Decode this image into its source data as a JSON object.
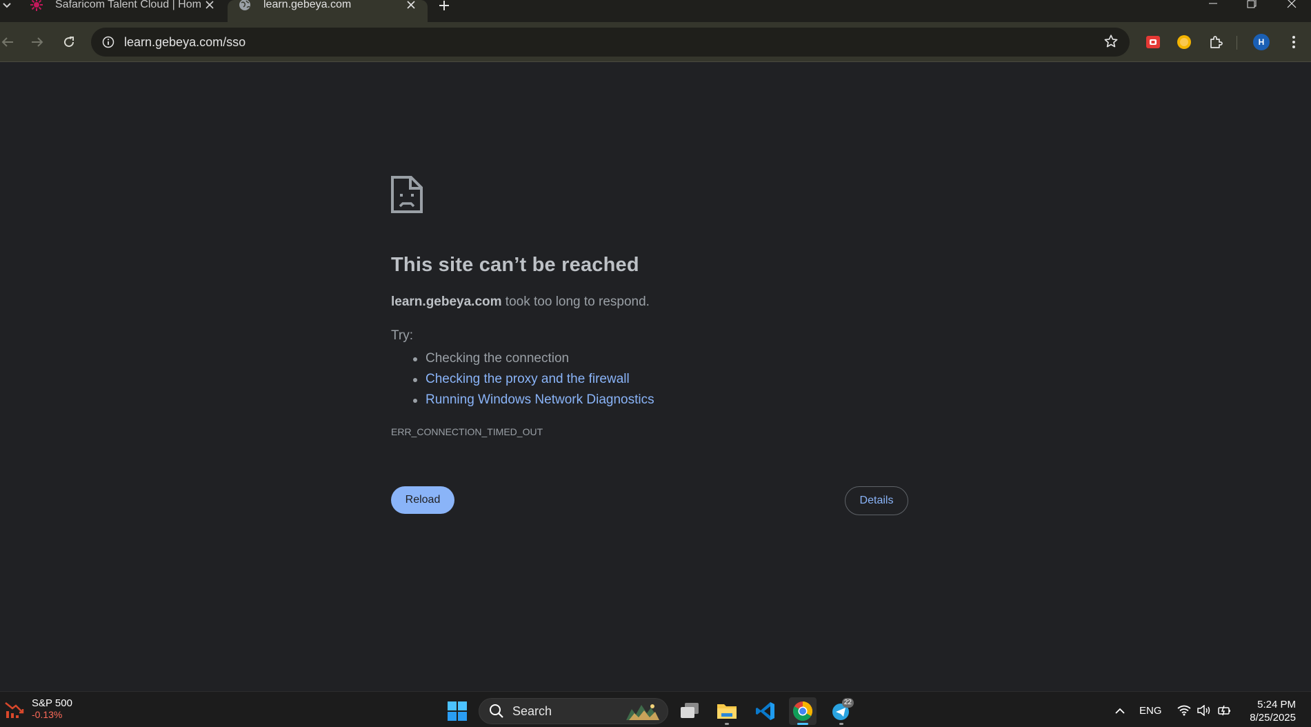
{
  "browser": {
    "tabs": [
      {
        "title": "Safaricom Talent Cloud | Home",
        "active": false
      },
      {
        "title": "learn.gebeya.com",
        "active": true
      }
    ],
    "url": "learn.gebeya.com/sso",
    "profile_initial": "H"
  },
  "error_page": {
    "title": "This site can’t be reached",
    "host": "learn.gebeya.com",
    "description_suffix": " took too long to respond.",
    "try_label": "Try:",
    "suggestions": [
      {
        "text": "Checking the connection",
        "is_link": false
      },
      {
        "text": "Checking the proxy and the firewall",
        "is_link": true
      },
      {
        "text": "Running Windows Network Diagnostics",
        "is_link": true
      }
    ],
    "error_code": "ERR_CONNECTION_TIMED_OUT",
    "reload_label": "Reload",
    "details_label": "Details"
  },
  "taskbar": {
    "widget": {
      "name": "S&P 500",
      "change": "-0.13%"
    },
    "search_label": "Search",
    "telegram_badge": "22",
    "language": "ENG",
    "time": "5:24 PM",
    "date": "8/25/2025"
  },
  "colors": {
    "page_background": "#202124",
    "link": "#8ab4f8",
    "reload_button": "#8ab4f8",
    "toolbar": "#35362c",
    "stock_change": "#ff6b5a"
  }
}
